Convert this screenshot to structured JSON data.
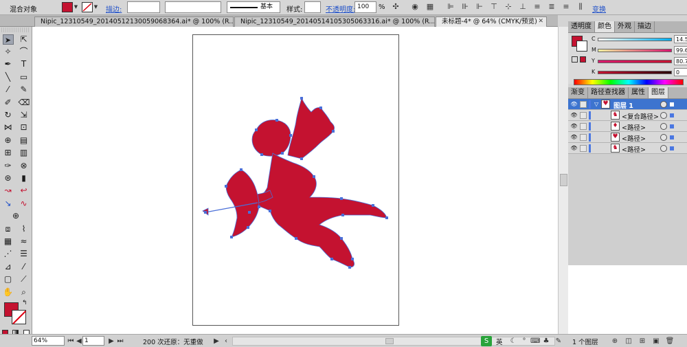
{
  "control_bar": {
    "selection_label": "混合对象",
    "fill_color": "#c41230",
    "stroke_label": "描边:",
    "basic_label": "基本",
    "style_label": "样式:",
    "opacity_label": "不透明度:",
    "opacity_value": "100",
    "percent": "%",
    "transform_label": "变换"
  },
  "tabs": [
    {
      "label": "Nipic_12310549_20140512130059068364.ai* @ 100% (R..."
    },
    {
      "label": "Nipic_12310549_20140514105305063316.ai* @ 100% (R..."
    },
    {
      "label": "未标题-4* @ 64% (CMYK/预览)"
    }
  ],
  "color_panel": {
    "tabs": [
      "透明度",
      "颜色",
      "外观",
      "描边"
    ],
    "channels": [
      {
        "label": "C",
        "value": "14.51",
        "gradient": "linear-gradient(90deg,#ffffff,#00aeef)"
      },
      {
        "label": "M",
        "value": "99.61",
        "gradient": "linear-gradient(90deg,#f2f2a0,#d6136c)"
      },
      {
        "label": "Y",
        "value": "80.78",
        "gradient": "linear-gradient(90deg,#d8196d,#c41230)"
      },
      {
        "label": "K",
        "value": "0",
        "gradient": "linear-gradient(90deg,#c41230,#2a0008)"
      }
    ]
  },
  "layers_panel": {
    "tabs": [
      "渐变",
      "路径查找器",
      "属性",
      "图层"
    ],
    "layers": [
      {
        "name": "图层 1",
        "icon": "heart-icon"
      },
      {
        "name": "<复合路径>",
        "icon": "cupid-icon"
      },
      {
        "name": "<路径>",
        "icon": "drop-icon"
      },
      {
        "name": "<路径>",
        "icon": "heart-icon"
      },
      {
        "name": "<路径>",
        "icon": "cupid-icon"
      }
    ]
  },
  "status_bar": {
    "zoom": "64%",
    "artboard_number": "1",
    "undo_text": "200 次还原：无重做",
    "ime_icon": "S",
    "ime_text": "英",
    "layer_count": "1 个图层"
  }
}
